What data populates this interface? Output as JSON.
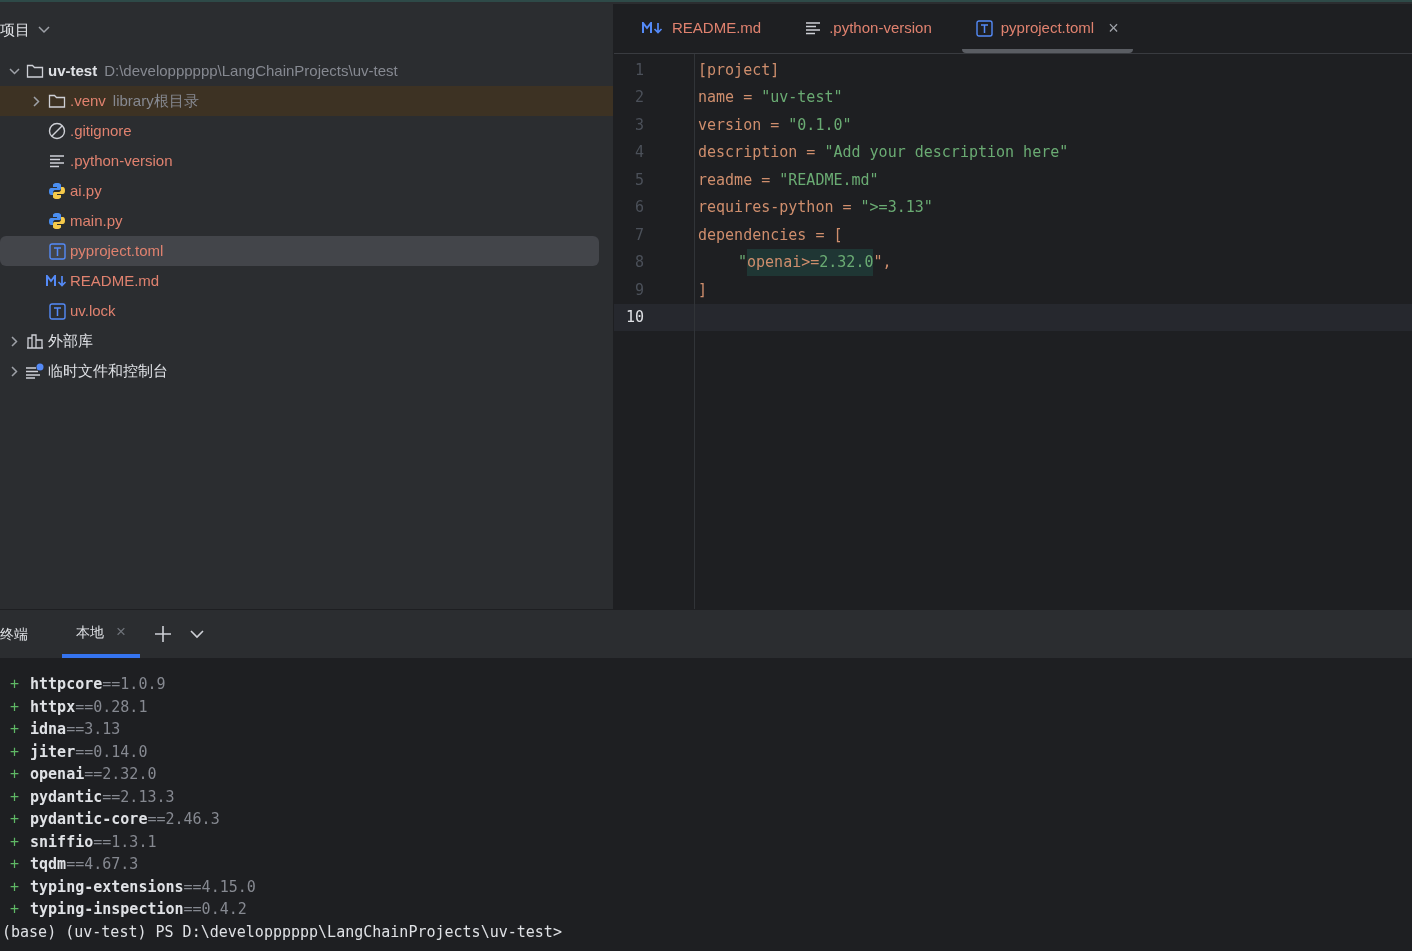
{
  "project_panel": {
    "title": "项目",
    "tree": [
      {
        "kind": "folder",
        "name": "uv-test",
        "hint": "D:\\developppppp\\LangChainProjects\\uv-test",
        "expanded": true,
        "selected": false,
        "highlighted": false,
        "children": [
          {
            "kind": "folder",
            "name": ".venv",
            "hint": "library根目录",
            "expanded": false,
            "selected": false,
            "highlighted": true
          },
          {
            "kind": "ignore",
            "name": ".gitignore",
            "selected": false,
            "highlighted": false
          },
          {
            "kind": "text",
            "name": ".python-version",
            "selected": false,
            "highlighted": false
          },
          {
            "kind": "python",
            "name": "ai.py",
            "selected": false,
            "highlighted": false
          },
          {
            "kind": "python",
            "name": "main.py",
            "selected": false,
            "highlighted": false
          },
          {
            "kind": "toml",
            "name": "pyproject.toml",
            "selected": true,
            "highlighted": false
          },
          {
            "kind": "markdown",
            "name": "README.md",
            "selected": false,
            "highlighted": false
          },
          {
            "kind": "toml",
            "name": "uv.lock",
            "selected": false,
            "highlighted": false
          }
        ]
      },
      {
        "kind": "library",
        "name": "外部库",
        "expanded": false,
        "selected": false,
        "highlighted": false
      },
      {
        "kind": "scratch",
        "name": "临时文件和控制台",
        "expanded": false,
        "selected": false,
        "highlighted": false
      }
    ]
  },
  "editor": {
    "tabs": [
      {
        "kind": "markdown",
        "label": "README.md",
        "selected": false
      },
      {
        "kind": "text",
        "label": ".python-version",
        "selected": false
      },
      {
        "kind": "toml",
        "label": "pyproject.toml",
        "selected": true,
        "close": "×"
      }
    ],
    "lines": [
      {
        "number": "1",
        "current": false,
        "segments": [
          {
            "text": "[project]",
            "kind": "key",
            "highlighted": false
          }
        ]
      },
      {
        "number": "2",
        "current": false,
        "segments": [
          {
            "text": "name = ",
            "kind": "key",
            "highlighted": false
          },
          {
            "text": "\"uv-test\"",
            "kind": "str",
            "highlighted": false
          }
        ]
      },
      {
        "number": "3",
        "current": false,
        "segments": [
          {
            "text": "version = ",
            "kind": "key",
            "highlighted": false
          },
          {
            "text": "\"0.1.0\"",
            "kind": "str",
            "highlighted": false
          }
        ]
      },
      {
        "number": "4",
        "current": false,
        "segments": [
          {
            "text": "description = ",
            "kind": "key",
            "highlighted": false
          },
          {
            "text": "\"Add your description here\"",
            "kind": "str",
            "highlighted": false
          }
        ]
      },
      {
        "number": "5",
        "current": false,
        "segments": [
          {
            "text": "readme = ",
            "kind": "key",
            "highlighted": false
          },
          {
            "text": "\"README.md\"",
            "kind": "str",
            "highlighted": false
          }
        ]
      },
      {
        "number": "6",
        "current": false,
        "segments": [
          {
            "text": "requires-python = ",
            "kind": "key",
            "highlighted": false
          },
          {
            "text": "\">=3.13\"",
            "kind": "str",
            "highlighted": false
          }
        ]
      },
      {
        "number": "7",
        "current": false,
        "segments": [
          {
            "text": "dependencies = [",
            "kind": "key",
            "highlighted": false
          }
        ]
      },
      {
        "number": "8",
        "current": false,
        "indent": true,
        "segments": [
          {
            "text": "\"",
            "kind": "str",
            "highlighted": false
          },
          {
            "text": "openai>=",
            "kind": "key",
            "highlighted": true
          },
          {
            "text": "2.32.0",
            "kind": "str",
            "highlighted": true
          },
          {
            "text": "\",",
            "kind": "key",
            "highlighted": false
          }
        ]
      },
      {
        "number": "9",
        "current": false,
        "segments": [
          {
            "text": "]",
            "kind": "key",
            "highlighted": false
          }
        ]
      },
      {
        "number": "10",
        "current": true
      }
    ]
  },
  "terminal": {
    "title": "终端",
    "tabs": [
      {
        "label": "本地",
        "selected": true,
        "close": "×"
      }
    ],
    "lines": [
      {
        "marker": "+",
        "package": "httpcore",
        "version": "==1.0.9"
      },
      {
        "marker": "+",
        "package": "httpx",
        "version": "==0.28.1"
      },
      {
        "marker": "+",
        "package": "idna",
        "version": "==3.13"
      },
      {
        "marker": "+",
        "package": "jiter",
        "version": "==0.14.0"
      },
      {
        "marker": "+",
        "package": "openai",
        "version": "==2.32.0"
      },
      {
        "marker": "+",
        "package": "pydantic",
        "version": "==2.13.3"
      },
      {
        "marker": "+",
        "package": "pydantic-core",
        "version": "==2.46.3"
      },
      {
        "marker": "+",
        "package": "sniffio",
        "version": "==1.3.1"
      },
      {
        "marker": "+",
        "package": "tqdm",
        "version": "==4.67.3"
      },
      {
        "marker": "+",
        "package": "typing-extensions",
        "version": "==4.15.0"
      },
      {
        "marker": "+",
        "package": "typing-inspection",
        "version": "==0.4.2"
      }
    ],
    "prompt": "(base) (uv-test) PS D:\\developppppp\\LangChainProjects\\uv-test>"
  }
}
